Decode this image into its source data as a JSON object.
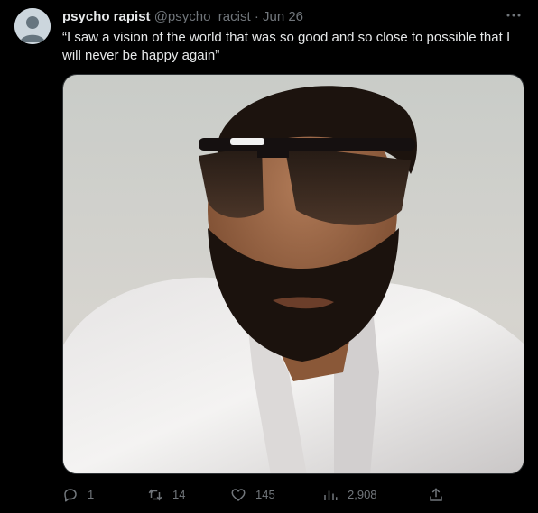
{
  "user": {
    "display_name": "psycho rapist",
    "handle": "@psycho_racist",
    "separator": "·",
    "date": "Jun 26"
  },
  "tweet": {
    "text": "“I saw a vision of the world that was so good and so close to possible that I will never be happy again”"
  },
  "media": {
    "subject": "man with dark beard, sunglasses and white open-collar shirt"
  },
  "actions": {
    "reply_count": "1",
    "retweet_count": "14",
    "like_count": "145",
    "view_count": "2,908"
  },
  "icons": {
    "more": "more-horizontal-icon",
    "reply": "reply-icon",
    "retweet": "retweet-icon",
    "like": "heart-icon",
    "views": "views-chart-icon",
    "share": "share-icon"
  },
  "colors": {
    "background": "#000000",
    "text": "#e7e9ea",
    "muted": "#71767b",
    "border": "#2f3336"
  }
}
